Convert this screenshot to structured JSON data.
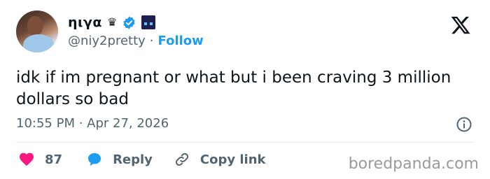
{
  "author": {
    "display_name": "ηιγα",
    "crown": "♛",
    "handle": "@niy2pretty",
    "separator": "·",
    "follow_label": "Follow"
  },
  "tweet": {
    "text": "idk if im pregnant or what but i been craving 3 million dollars so bad",
    "timestamp": "10:55 PM · Apr 27, 2026"
  },
  "actions": {
    "like_count": "87",
    "reply_label": "Reply",
    "copy_link_label": "Copy link"
  },
  "watermark": "boredpanda.com",
  "colors": {
    "accent": "#1d9bf0",
    "like": "#f91880",
    "text": "#0f1419",
    "muted": "#536471"
  },
  "icons": [
    "crown-icon",
    "verified-badge-icon",
    "pixel-emoji-icon",
    "x-logo-icon",
    "info-icon",
    "heart-icon",
    "reply-bubble-icon",
    "link-icon"
  ]
}
